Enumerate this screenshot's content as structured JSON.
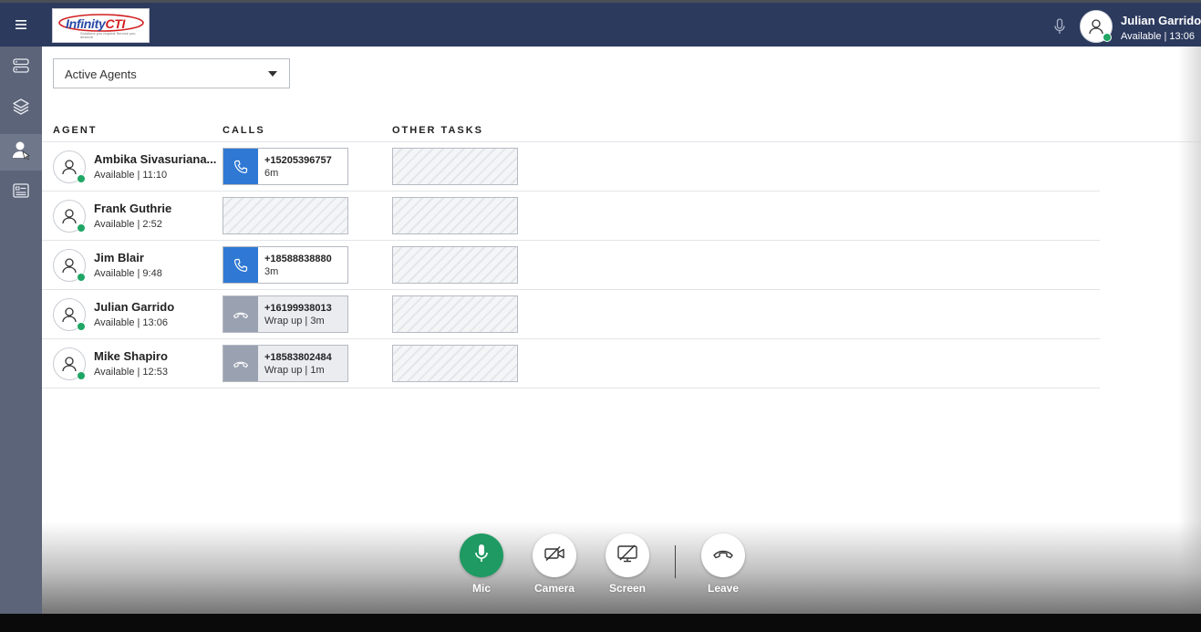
{
  "header": {
    "logo_text_a": "Infinity",
    "logo_text_b": "CTI",
    "logo_tagline": "Solutions you request Service you deserve",
    "user_name": "Julian Garrido",
    "user_status": "Available | 13:06"
  },
  "filter": {
    "selected": "Active Agents"
  },
  "columns": {
    "agent": "AGENT",
    "calls": "CALLS",
    "other_tasks": "OTHER TASKS"
  },
  "agents": [
    {
      "name": "Ambika Sivasuriana...",
      "status": "Available | 11:10",
      "call": {
        "number": "+15205396757",
        "detail": "6m",
        "state": "active"
      }
    },
    {
      "name": "Frank Guthrie",
      "status": "Available | 2:52",
      "call": null
    },
    {
      "name": "Jim Blair",
      "status": "Available | 9:48",
      "call": {
        "number": "+18588838880",
        "detail": "3m",
        "state": "active"
      }
    },
    {
      "name": "Julian Garrido",
      "status": "Available | 13:06",
      "call": {
        "number": "+16199938013",
        "detail": "Wrap up | 3m",
        "state": "wrap"
      }
    },
    {
      "name": "Mike Shapiro",
      "status": "Available | 12:53",
      "call": {
        "number": "+18583802484",
        "detail": "Wrap up | 1m",
        "state": "wrap"
      }
    }
  ],
  "controls": {
    "mic": "Mic",
    "camera": "Camera",
    "screen": "Screen",
    "leave": "Leave"
  },
  "colors": {
    "header": "#2c3a5e",
    "rail": "#5b6478",
    "active_call": "#2f79d4",
    "wrap_call": "#9aa1b1",
    "presence": "#20a665",
    "mic_on": "#1e9a62"
  }
}
